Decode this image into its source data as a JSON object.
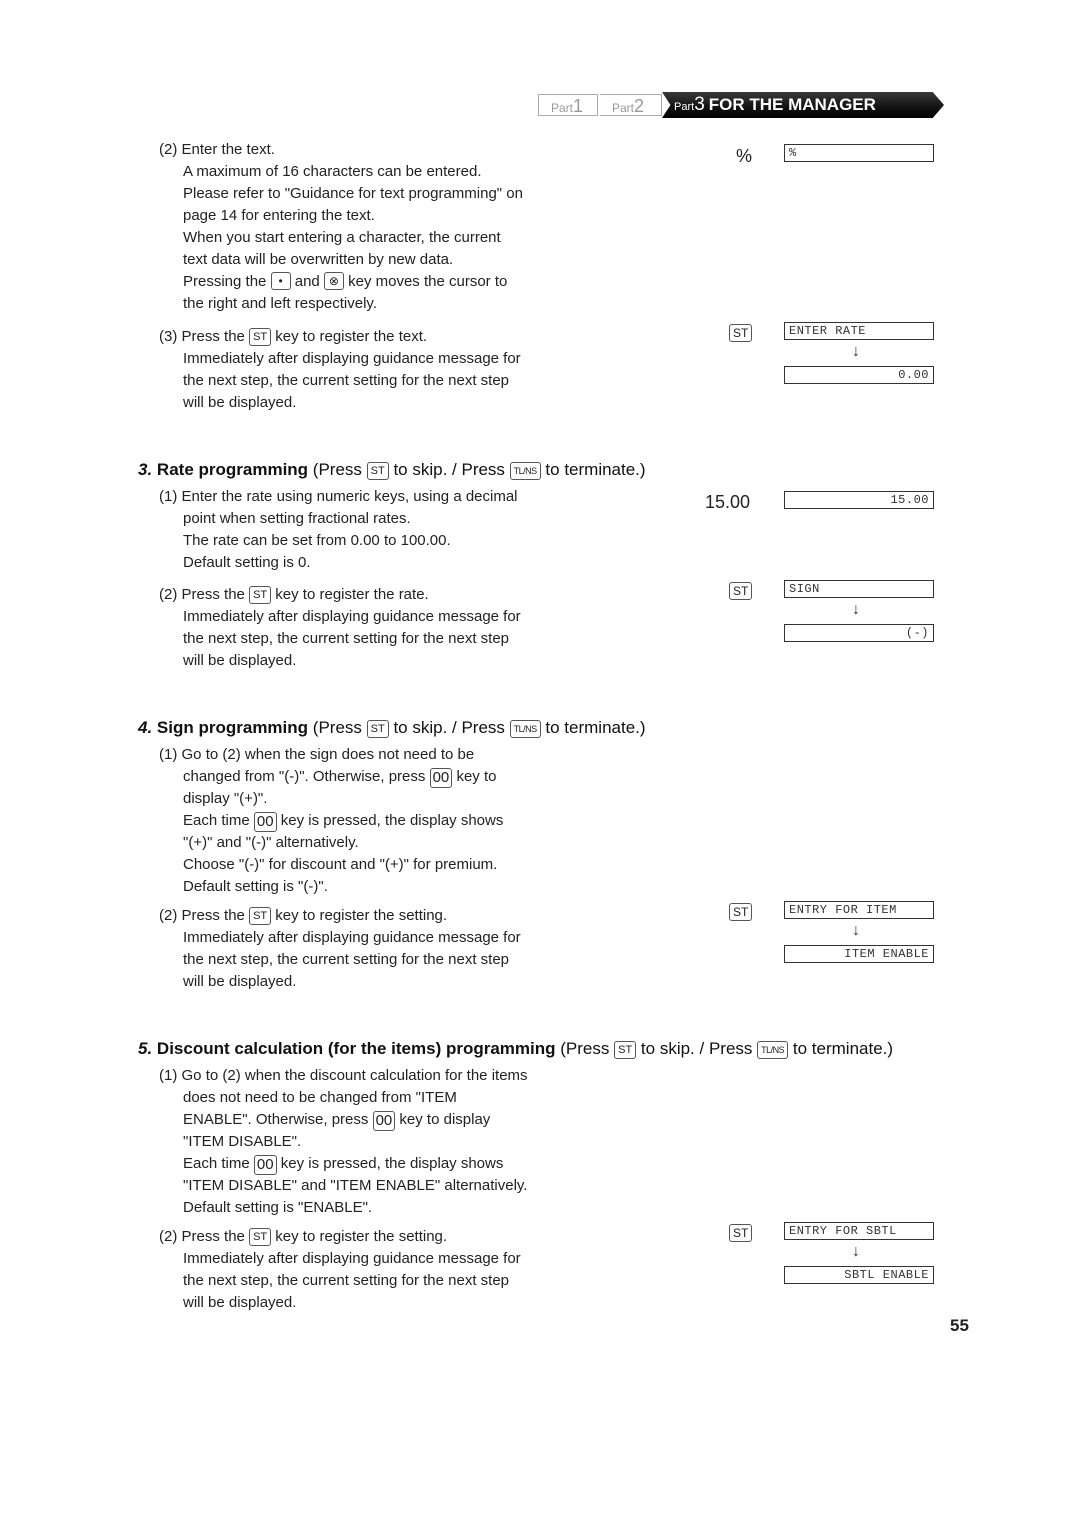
{
  "header": {
    "part1": {
      "prefix": "Part",
      "num": "1"
    },
    "part2": {
      "prefix": "Part",
      "num": "2"
    },
    "part3": {
      "prefix": "Part",
      "num": "3",
      "title": "FOR THE MANAGER"
    }
  },
  "keys": {
    "st": "ST",
    "tlns": "TL/NS",
    "dot": "•",
    "x": "⊗",
    "oo": "00"
  },
  "section2": {
    "step2": {
      "num": "(2)",
      "lines": [
        "Enter the text.",
        "A maximum of 16 characters can be entered.",
        "Please refer to \"Guidance for text programming\" on",
        "page 14 for entering the text.",
        "When you start entering a character, the current",
        "text data will be overwritten by new data.",
        "Pressing the",
        "and",
        "key moves the cursor to",
        "the right and left respectively."
      ]
    },
    "step3": {
      "num": "(3)",
      "pre": "Press the",
      "post": "key to register the text.",
      "lines": [
        "Immediately after displaying guidance message for",
        "the next step, the current setting for the next step",
        "will be displayed."
      ]
    },
    "side": {
      "input": "%",
      "display1": "%",
      "key": "ST",
      "display2": "ENTER RATE",
      "display3": "0.00"
    }
  },
  "section3": {
    "num": "3.",
    "title": "Rate programming",
    "hint_pre": "(Press",
    "hint_mid": "to skip. / Press",
    "hint_post": "to terminate.)",
    "step1": {
      "num": "(1)",
      "lines": [
        "Enter the rate using numeric keys, using a decimal",
        "point when setting fractional rates.",
        "The rate can be set from 0.00 to 100.00.",
        "Default setting is 0."
      ]
    },
    "step2": {
      "num": "(2)",
      "pre": "Press the",
      "post": "key to register the rate.",
      "lines": [
        "Immediately after displaying guidance message for",
        "the next step, the current setting for the next step",
        "will be displayed."
      ]
    },
    "side": {
      "input": "15.00",
      "display1": "15.00",
      "key": "ST",
      "display2": "SIGN",
      "display3": "(-)"
    }
  },
  "section4": {
    "num": "4.",
    "title": "Sign programming",
    "hint_pre": "(Press",
    "hint_mid": "to skip. / Press",
    "hint_post": "to terminate.)",
    "step1": {
      "num": "(1)",
      "l1": "Go to (2) when the sign does not need to be",
      "l2_pre": "changed from \"(-)\".  Otherwise, press",
      "l2_post": "key to",
      "l3": "display \"(+)\".",
      "l4_pre": "Each time",
      "l4_post": "key is pressed, the display shows",
      "l5": "\"(+)\" and \"(-)\" alternatively.",
      "l6": "Choose \"(-)\" for discount and \"(+)\" for premium.",
      "l7": "Default setting is \"(-)\"."
    },
    "step2": {
      "num": "(2)",
      "pre": "Press the",
      "post": "key to register the setting.",
      "lines": [
        "Immediately after displaying guidance message for",
        "the next step, the current setting for the next step",
        "will be displayed."
      ]
    },
    "side": {
      "key": "ST",
      "display1": "ENTRY FOR ITEM",
      "display2": "ITEM ENABLE"
    }
  },
  "section5": {
    "num": "5.",
    "title": "Discount calculation (for the items) programming",
    "hint_pre": "(Press",
    "hint_mid": "to skip. / Press",
    "hint_post": "to terminate.)",
    "step1": {
      "num": "(1)",
      "l1": "Go to (2) when the discount calculation for the items",
      "l2": "does not need to be changed from \"ITEM",
      "l3_pre": "ENABLE\".  Otherwise, press",
      "l3_post": "key to display",
      "l4": "\"ITEM DISABLE\".",
      "l5_pre": "Each time",
      "l5_post": "key is pressed, the display shows",
      "l6": "\"ITEM DISABLE\" and \"ITEM ENABLE\" alternatively.",
      "l7": "Default setting is \"ENABLE\"."
    },
    "step2": {
      "num": "(2)",
      "pre": "Press the",
      "post": "key to register the setting.",
      "lines": [
        "Immediately after displaying guidance message for",
        "the next step, the current setting for the next step",
        "will be displayed."
      ]
    },
    "side": {
      "key": "ST",
      "display1": "ENTRY FOR SBTL",
      "display2": "SBTL ENABLE"
    }
  },
  "arrow": "↓",
  "page_number": "55"
}
